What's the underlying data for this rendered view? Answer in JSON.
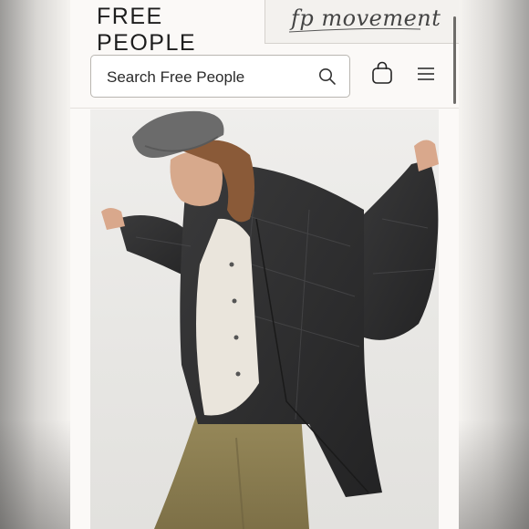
{
  "tabs": {
    "brand": "FREE PEOPLE",
    "movement": "fp movement"
  },
  "search": {
    "placeholder": "Search Free People"
  },
  "icons": {
    "search": "search-icon",
    "bag": "shopping-bag-icon",
    "menu": "hamburger-menu-icon"
  },
  "product": {
    "image": "model wearing black quilted jacket, grey beret, white shirt and olive pants"
  }
}
